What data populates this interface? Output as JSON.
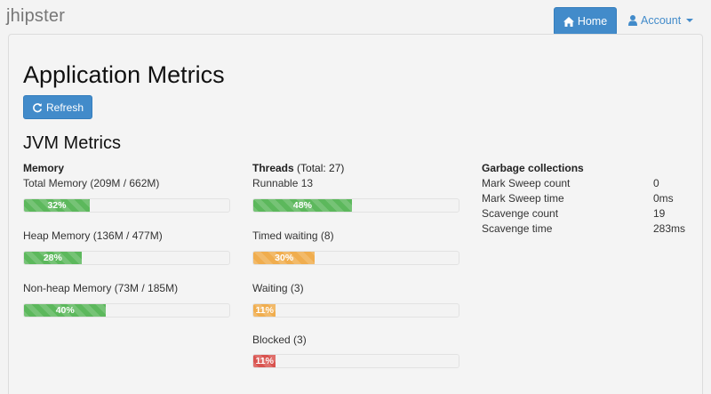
{
  "navbar": {
    "brand": "jhipster",
    "home_label": "Home",
    "account_label": "Account",
    "colors": {
      "primary": "#428bca",
      "brand_text": "#777777"
    }
  },
  "page": {
    "title": "Application Metrics",
    "refresh_label": "Refresh",
    "section_title": "JVM Metrics"
  },
  "memory": {
    "heading": "Memory",
    "items": [
      {
        "label": "Total Memory (209M / 662M)",
        "percent": 32,
        "percent_label": "32%",
        "color": "#5cb85c"
      },
      {
        "label": "Heap Memory (136M / 477M)",
        "percent": 28,
        "percent_label": "28%",
        "color": "#5cb85c"
      },
      {
        "label": "Non-heap Memory (73M / 185M)",
        "percent": 40,
        "percent_label": "40%",
        "color": "#5cb85c"
      }
    ]
  },
  "threads": {
    "heading": "Threads",
    "total": "(Total: 27)",
    "items": [
      {
        "label": "Runnable 13",
        "percent": 48,
        "percent_label": "48%",
        "color": "#5cb85c"
      },
      {
        "label": "Timed waiting (8)",
        "percent": 30,
        "percent_label": "30%",
        "color": "#f0ad4e"
      },
      {
        "label": "Waiting (3)",
        "percent": 11,
        "percent_label": "11%",
        "color": "#f0ad4e"
      },
      {
        "label": "Blocked (3)",
        "percent": 11,
        "percent_label": "11%",
        "color": "#d9534f"
      }
    ]
  },
  "gc": {
    "heading": "Garbage collections",
    "rows": [
      {
        "key": "Mark Sweep count",
        "value": "0"
      },
      {
        "key": "Mark Sweep time",
        "value": "0ms"
      },
      {
        "key": "Scavenge count",
        "value": "19"
      },
      {
        "key": "Scavenge time",
        "value": "283ms"
      }
    ]
  }
}
